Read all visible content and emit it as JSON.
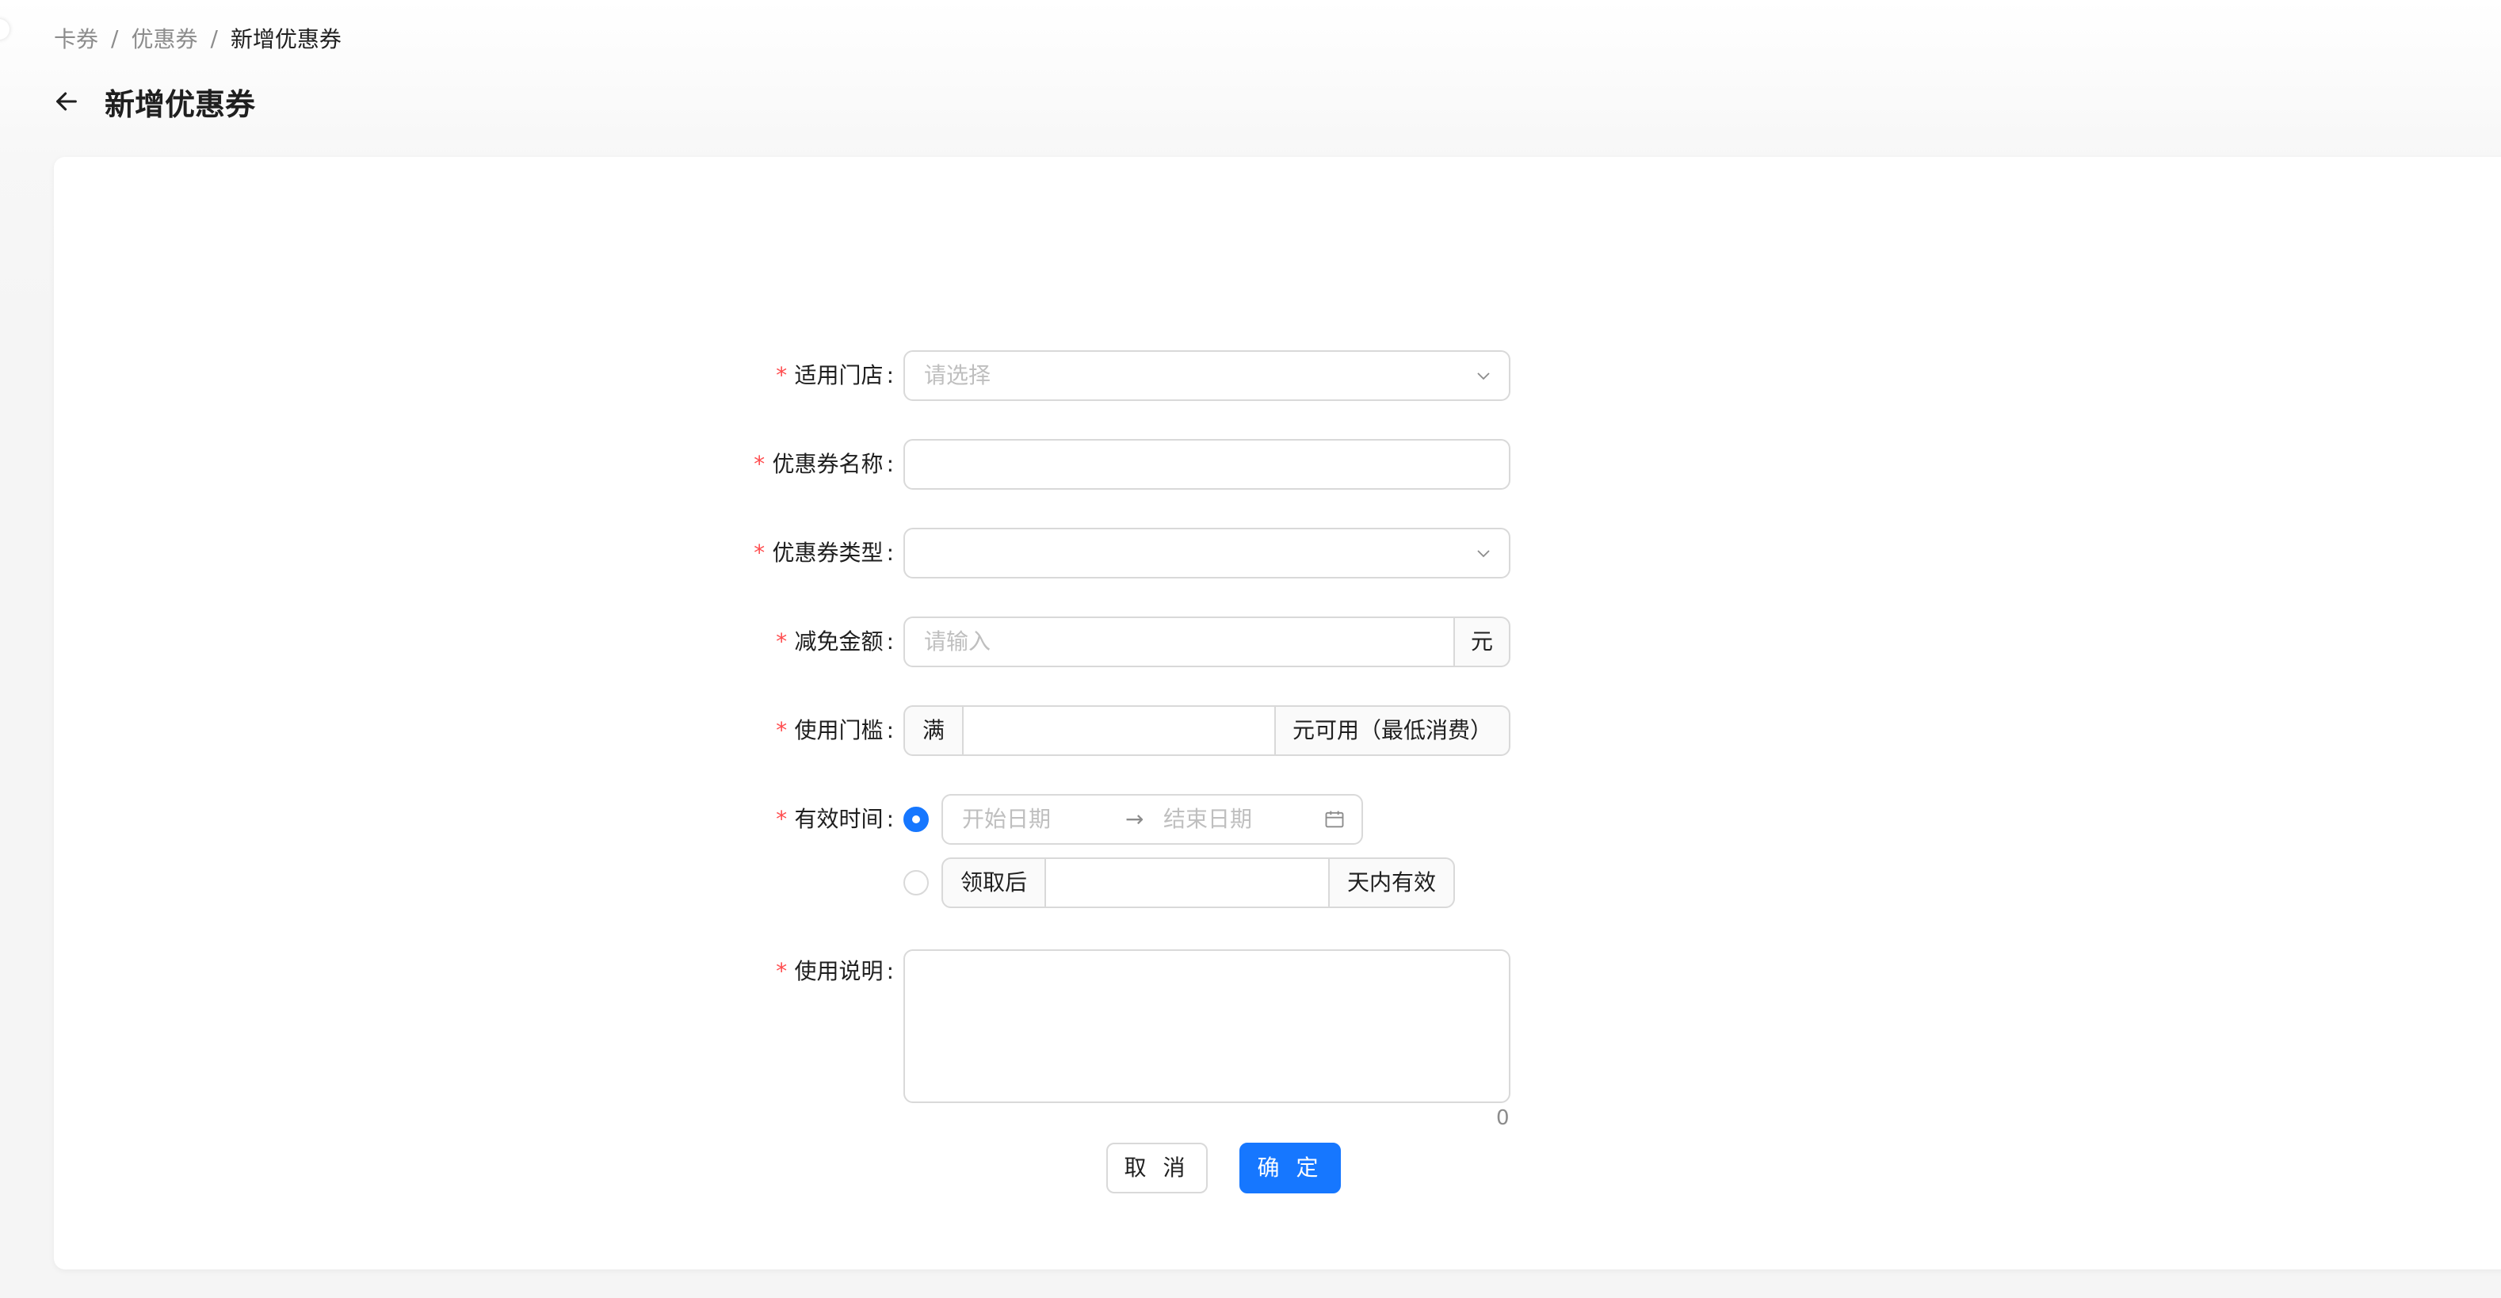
{
  "breadcrumb": {
    "items": [
      "卡券",
      "优惠券",
      "新增优惠券"
    ],
    "separator": "/"
  },
  "header": {
    "title": "新增优惠券",
    "back_icon": "arrow-left-icon"
  },
  "form": {
    "required_mark": "*",
    "colon": ":",
    "store": {
      "label": "适用门店",
      "placeholder": "请选择",
      "icon": "chevron-down-icon"
    },
    "coupon_name": {
      "label": "优惠券名称",
      "value": ""
    },
    "coupon_type": {
      "label": "优惠券类型",
      "value": "",
      "icon": "chevron-down-icon"
    },
    "discount_amount": {
      "label": "减免金额",
      "placeholder": "请输入",
      "suffix": "元"
    },
    "threshold": {
      "label": "使用门槛",
      "prefix": "满",
      "value": "",
      "suffix": "元可用（最低消费）"
    },
    "valid_time": {
      "label": "有效时间",
      "option_range": {
        "selected": true,
        "start_placeholder": "开始日期",
        "arrow": "→",
        "end_placeholder": "结束日期",
        "icon": "calendar-icon"
      },
      "option_days": {
        "selected": false,
        "prefix": "领取后",
        "value": "",
        "suffix": "天内有效"
      }
    },
    "description": {
      "label": "使用说明",
      "value": "",
      "count": "0"
    }
  },
  "actions": {
    "cancel_label": "取 消",
    "confirm_label": "确 定"
  },
  "colors": {
    "primary": "#1677ff",
    "required": "#ff4d4f",
    "border": "#d9d9d9",
    "placeholder": "#bfbfbf"
  }
}
